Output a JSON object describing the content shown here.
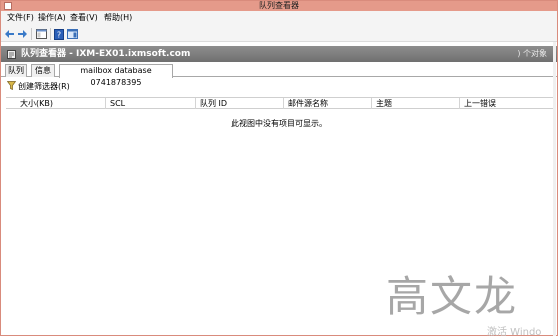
{
  "window": {
    "title": "队列查看器"
  },
  "menu": [
    "文件(F)",
    "操作(A)",
    "查看(V)",
    "帮助(H)"
  ],
  "toolbar": {
    "icons": [
      "back-arrow-icon",
      "forward-arrow-icon",
      "console-tree-icon",
      "help-icon",
      "action-pane-icon"
    ],
    "colors": {
      "arrow": "#3a7ac8",
      "help": "#2a5fb8"
    }
  },
  "header": {
    "title": "队列查看器 - IXM-EX01.ixmsoft.com",
    "count": ") 个对象"
  },
  "tabs": [
    "队列",
    "信息",
    "mailbox database 0741878395"
  ],
  "active_tab": 2,
  "filter": {
    "label": "创建筛选器(R)"
  },
  "columns": [
    "大小(KB)",
    "SCL",
    "队列 ID",
    "邮件源名称",
    "主题",
    "上一错误"
  ],
  "empty_message": "此视图中没有项目可显示。",
  "watermark": "高文龙",
  "activation": "激活 Windo"
}
